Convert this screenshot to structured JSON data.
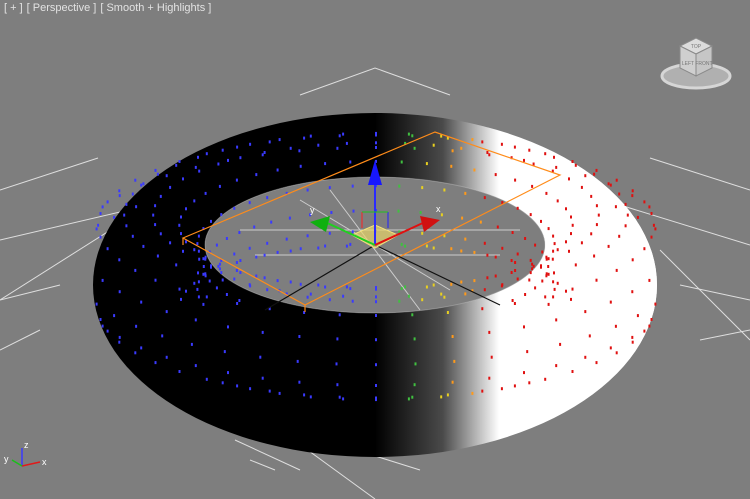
{
  "viewport": {
    "label_plus": "[ + ]",
    "label_view": "[ Perspective ]",
    "label_shading": "[ Smooth + Highlights ]"
  },
  "viewcube": {
    "face_top": "TOP",
    "face_left": "LEFT",
    "face_front": "FRONT"
  },
  "axis_tripod": {
    "x": "x",
    "y": "y",
    "z": "z"
  },
  "gizmo": {
    "x": "x",
    "y": "y"
  },
  "colors": {
    "background": "#7e7e7e",
    "grid": "#e8e8e8",
    "selection_box": "#ff8c1a",
    "vertex_blue": "#3a3aff",
    "axis_x": "#e01010",
    "axis_y": "#10c010",
    "axis_z": "#1010e0"
  },
  "icons": {
    "viewcube": "viewcube-icon",
    "axis_tripod": "axis-tripod-icon",
    "transform_gizmo": "move-gizmo-icon"
  }
}
